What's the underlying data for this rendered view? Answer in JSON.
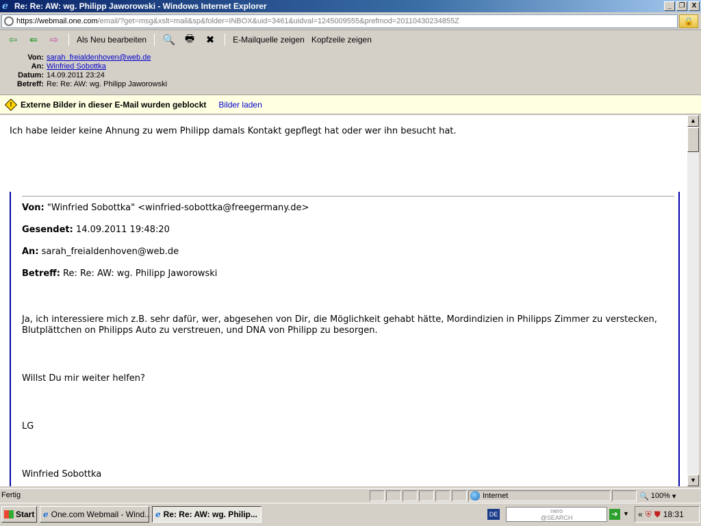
{
  "window": {
    "title": "Re: Re: AW: wg. Philipp Jaworowski - Windows Internet Explorer",
    "btn_minimize": "_",
    "btn_restore": "❐",
    "btn_close": "X"
  },
  "address": {
    "proto": "https://",
    "host": "webmail.one.com",
    "path": "/email/?get=msg&xslt=mail&sp&folder=INBOX&uid=3461&uidval=1245009555&prefmod=20110430234855Z"
  },
  "toolbar": {
    "edit_as_new": "Als Neu bearbeiten",
    "show_source": "E-Mailquelle zeigen",
    "show_headers": "Kopfzeile zeigen"
  },
  "headers": {
    "from_label": "Von:",
    "from_value": "sarah_freialdenhoven@web.de",
    "to_label": "An:",
    "to_value": "Winfried Sobottka",
    "date_label": "Datum:",
    "date_value": "14.09.2011 23:24",
    "subject_label": "Betreff:",
    "subject_value": "Re: Re: AW: wg. Philipp Jaworowski"
  },
  "warning": {
    "text": "Externe Bilder in dieser E-Mail wurden geblockt",
    "link": "Bilder laden"
  },
  "body": {
    "first_paragraph": "Ich habe leider keine Ahnung zu wem Philipp damals Kontakt gepflegt hat oder wer ihn besucht hat.",
    "quote": {
      "from_label": "Von:",
      "from_value": "\"Winfried Sobottka\" <winfried-sobottka@freegermany.de>",
      "sent_label": "Gesendet:",
      "sent_value": "14.09.2011 19:48:20",
      "to_label": "An:",
      "to_value": "sarah_freialdenhoven@web.de",
      "subject_label": "Betreff:",
      "subject_value": "Re: Re: AW: wg. Philipp Jaworowski",
      "para1_line1": "Ja, ich interessiere mich z.B. sehr dafür, wer, abgesehen von Dir, die Möglichkeit gehabt hätte, Mordindizien in Philipps Zimmer zu verstecken,",
      "para1_line2": "Blutplättchen on Philipps Auto zu verstreuen, und DNA von Philipp zu besorgen.",
      "para2": "Willst Du mir weiter helfen?",
      "para3": "LG",
      "para4": "Winfried Sobottka"
    }
  },
  "status": {
    "text": "Fertig",
    "zone": "Internet",
    "zoom": "100%"
  },
  "taskbar": {
    "start": "Start",
    "task1": "One.com Webmail - Wind...",
    "task2": "Re: Re: AW: wg. Philip...",
    "lang": "DE",
    "nero_line1": "nero",
    "nero_line2": "@SEARCH",
    "clock": "18:31"
  }
}
